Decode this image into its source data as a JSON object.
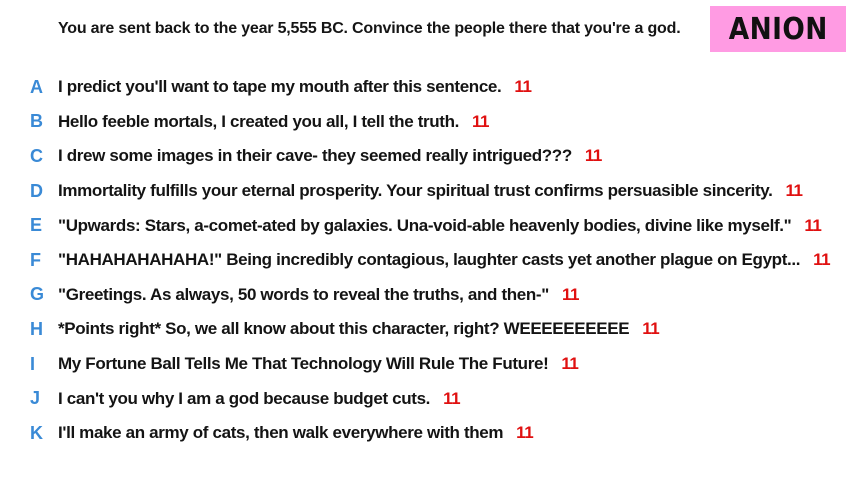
{
  "prompt": "You are sent back to the year 5,555 BC. Convince the people there that you're a god.",
  "badge": {
    "label": "ANION",
    "color": "#ff9be3"
  },
  "colors": {
    "letter": "#3a8ad6",
    "score": "#e01010",
    "text": "#141414"
  },
  "answers": [
    {
      "letter": "A",
      "text": "I predict you'll want to tape my mouth after this sentence.",
      "score": "11"
    },
    {
      "letter": "B",
      "text": "Hello feeble mortals, I created you all, I tell the truth.",
      "score": "11"
    },
    {
      "letter": "C",
      "text": "I drew some images in their cave- they seemed really intrigued???",
      "score": "11"
    },
    {
      "letter": "D",
      "text": "Immortality fulfills your eternal prosperity. Your spiritual trust confirms persuasible sincerity.",
      "score": "11"
    },
    {
      "letter": "E",
      "text": "\"Upwards: Stars, a-comet-ated by galaxies. Una-void-able heavenly bodies, divine like myself.\"",
      "score": "11"
    },
    {
      "letter": "F",
      "text": "\"HAHAHAHAHAHA!\" Being incredibly contagious, laughter casts yet another plague on Egypt...",
      "score": "11"
    },
    {
      "letter": "G",
      "text": "\"Greetings. As always, 50 words to reveal the truths, and then-\"",
      "score": "11"
    },
    {
      "letter": "H",
      "text": "*Points right* So, we all know about this character, right? WEEEEEEEEEE",
      "score": "11"
    },
    {
      "letter": "I",
      "text": "My Fortune Ball Tells Me That Technology Will Rule The Future!",
      "score": "11"
    },
    {
      "letter": "J",
      "text": "I can't you why I am a god because budget cuts.",
      "score": "11"
    },
    {
      "letter": "K",
      "text": "I'll make an army of cats, then walk everywhere with them",
      "score": "11"
    }
  ]
}
